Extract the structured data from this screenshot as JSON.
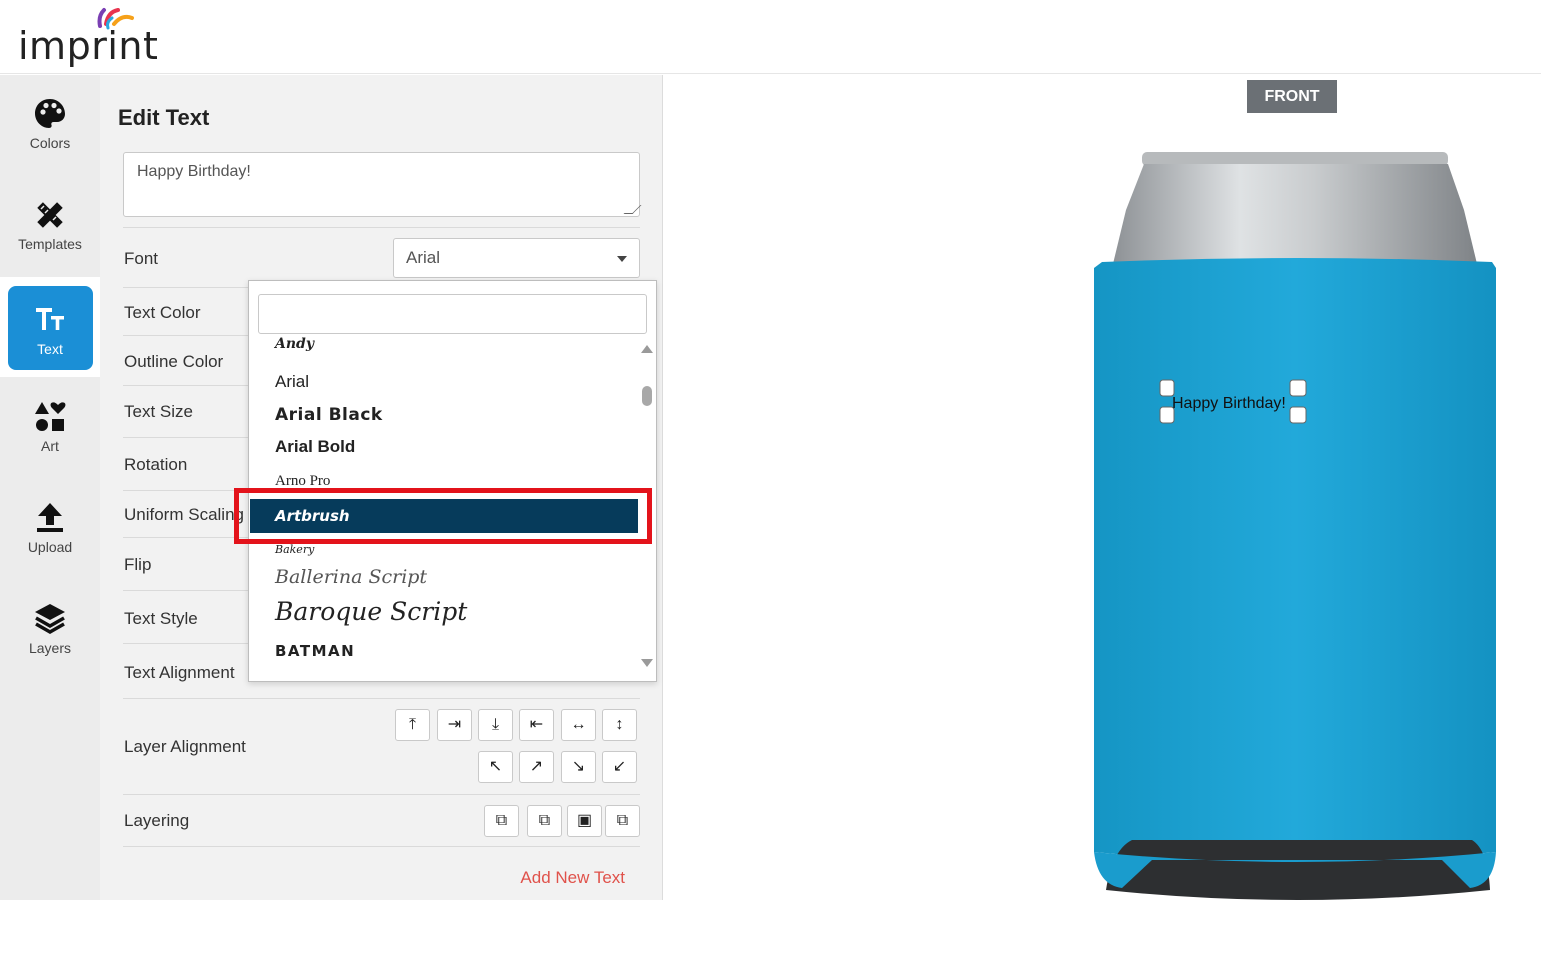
{
  "logo": {
    "text": "imprint"
  },
  "sidebar": {
    "items": [
      {
        "label": "Colors",
        "icon": "palette-icon"
      },
      {
        "label": "Templates",
        "icon": "pencil-ruler-icon"
      },
      {
        "label": "Text",
        "icon": "text-icon",
        "active": true
      },
      {
        "label": "Art",
        "icon": "shapes-icon"
      },
      {
        "label": "Upload",
        "icon": "upload-icon"
      },
      {
        "label": "Layers",
        "icon": "layers-icon"
      }
    ]
  },
  "panel": {
    "title": "Edit Text",
    "text_value": "Happy Birthday!",
    "rows": {
      "font": "Font",
      "text_color": "Text Color",
      "outline_color": "Outline Color",
      "text_size": "Text Size",
      "rotation": "Rotation",
      "uniform_scaling": "Uniform Scaling",
      "flip": "Flip",
      "text_style": "Text Style",
      "text_alignment": "Text Alignment",
      "layer_alignment": "Layer Alignment",
      "layering": "Layering"
    },
    "font_selected": "Arial",
    "add_new_text": "Add New Text"
  },
  "font_dropdown": {
    "search_value": "",
    "items": [
      "Andy",
      "Arial",
      "Arial Black",
      "Arial Bold",
      "Arno Pro",
      "Artbrush",
      "Bakery",
      "Ballerina Script",
      "Baroque Script",
      "BATMAN"
    ],
    "highlighted": "Artbrush"
  },
  "canvas": {
    "side_label": "FRONT",
    "design_text": "Happy Birthday!",
    "product_color": "#1ea7d6"
  },
  "colors": {
    "accent": "#1b8fd6",
    "selected_item": "#063b5b",
    "highlight_box": "#e3131b",
    "link": "#e0524b"
  }
}
